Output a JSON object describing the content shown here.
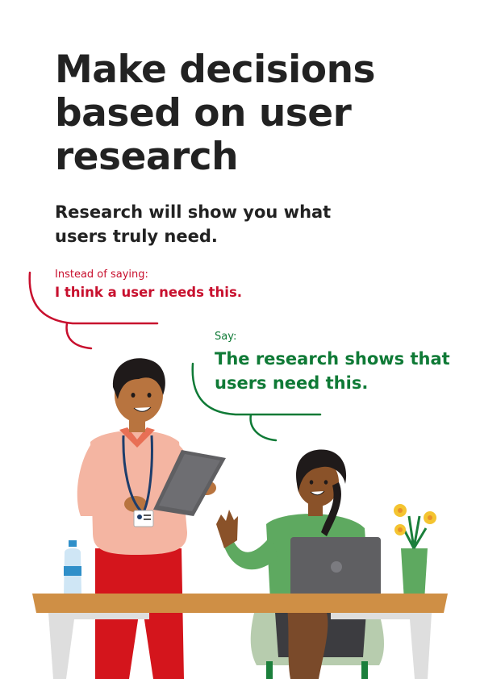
{
  "heading": {
    "title": "Make decisions based on user research"
  },
  "subheading": {
    "text": "Research will show you what users truly need."
  },
  "bubble_instead": {
    "label": "Instead of saying:",
    "quote": "I think a user needs this."
  },
  "bubble_say": {
    "label": "Say:",
    "quote": "The research shows that users need this."
  },
  "colors": {
    "red": "#c8102e",
    "green": "#0f7a36",
    "text": "#222222",
    "table": "#cf8f45"
  }
}
